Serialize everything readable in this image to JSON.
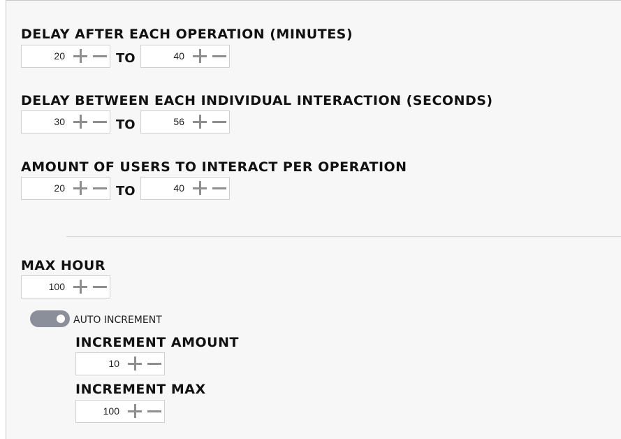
{
  "delay_after_operation": {
    "label": "DELAY AFTER EACH OPERATION (MINUTES)",
    "from": "20",
    "to_label": "TO",
    "to": "40"
  },
  "delay_between_interaction": {
    "label": "DELAY BETWEEN EACH INDIVIDUAL INTERACTION (SECONDS)",
    "from": "30",
    "to_label": "TO",
    "to": "56"
  },
  "users_per_operation": {
    "label": "AMOUNT OF USERS TO INTERACT PER OPERATION",
    "from": "20",
    "to_label": "TO",
    "to": "40"
  },
  "max_hour": {
    "label": "MAX HOUR",
    "value": "100"
  },
  "auto_increment": {
    "label": "AUTO INCREMENT",
    "enabled": true
  },
  "increment_amount": {
    "label": "INCREMENT AMOUNT",
    "value": "10"
  },
  "increment_max": {
    "label": "INCREMENT MAX",
    "value": "100"
  },
  "icons": {
    "increment": "plus-icon",
    "decrement": "minus-icon"
  },
  "colors": {
    "toggle_track": "#8a8f99",
    "icon": "#8e8e8e",
    "panel_bg": "#f7f7f7"
  }
}
